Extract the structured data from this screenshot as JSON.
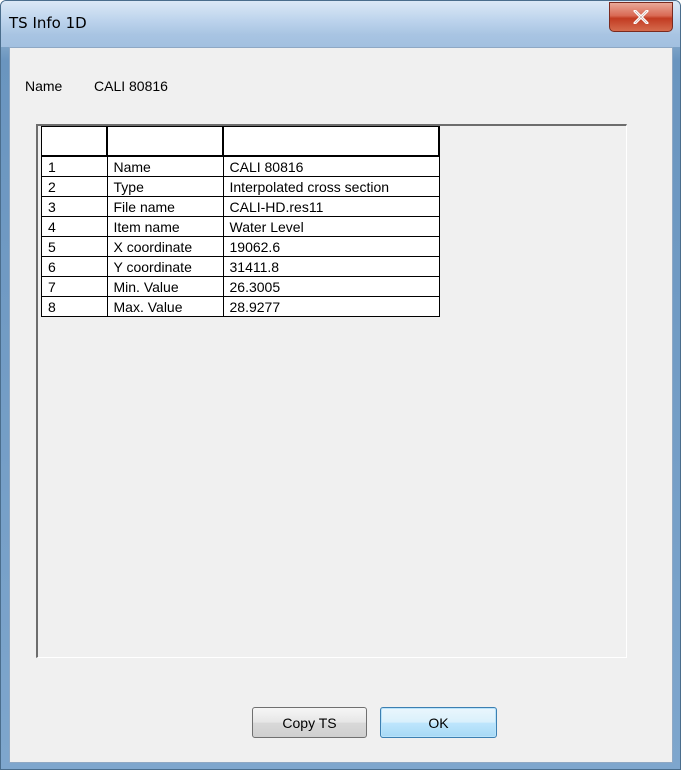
{
  "window": {
    "title": "TS Info 1D",
    "close_icon": "close-icon"
  },
  "name_row": {
    "label": "Name",
    "value": "CALI 80816"
  },
  "table": {
    "headers": [
      "",
      "",
      ""
    ],
    "rows": [
      {
        "index": "1",
        "key": "Name",
        "value": "CALI 80816"
      },
      {
        "index": "2",
        "key": "Type",
        "value": "Interpolated cross section"
      },
      {
        "index": "3",
        "key": "File name",
        "value": "CALI-HD.res11"
      },
      {
        "index": "4",
        "key": "Item name",
        "value": "Water Level"
      },
      {
        "index": "5",
        "key": "X coordinate",
        "value": "19062.6"
      },
      {
        "index": "6",
        "key": "Y coordinate",
        "value": "31411.8"
      },
      {
        "index": "7",
        "key": "Min. Value",
        "value": "26.3005"
      },
      {
        "index": "8",
        "key": "Max. Value",
        "value": "28.9277"
      }
    ]
  },
  "buttons": {
    "copy_ts": "Copy TS",
    "ok": "OK"
  },
  "colors": {
    "close_button": "#c23b22",
    "ok_button_border": "#3c7fb1",
    "dialog_background": "#f0f0f0"
  }
}
